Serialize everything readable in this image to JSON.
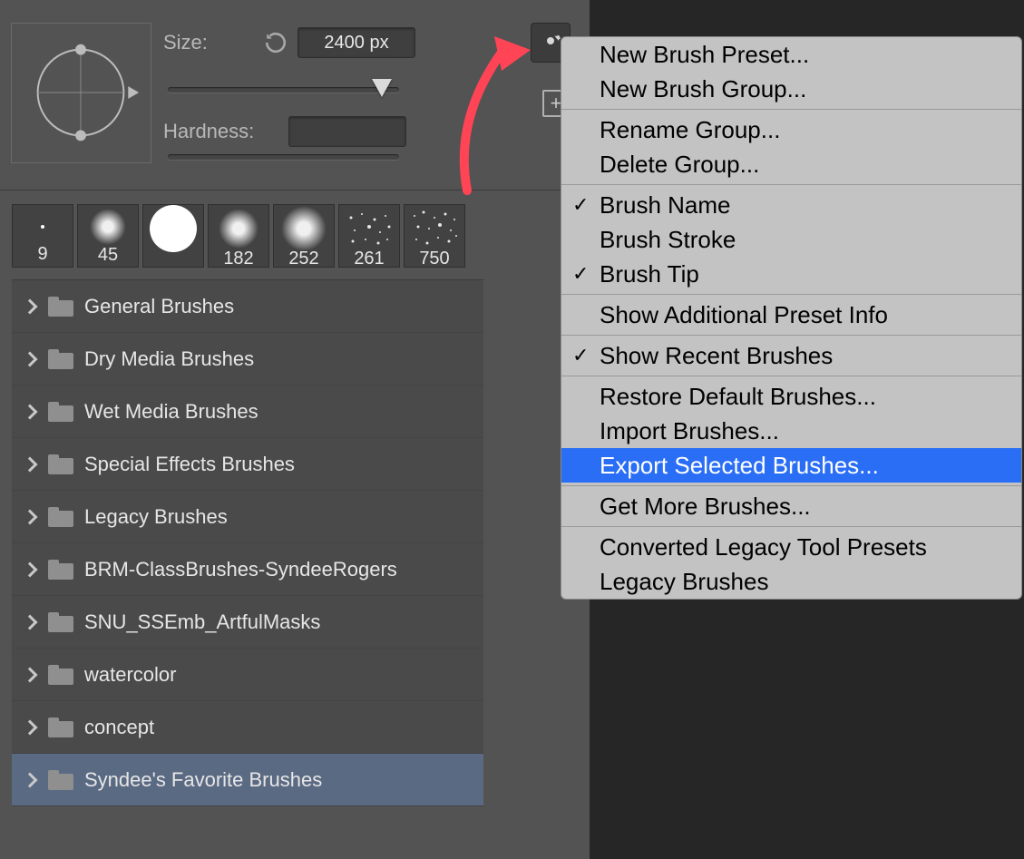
{
  "controls": {
    "size_label": "Size:",
    "size_value": "2400 px",
    "hardness_label": "Hardness:",
    "hardness_value": ""
  },
  "thumbs": [
    {
      "size": "9"
    },
    {
      "size": "45"
    },
    {
      "size": ""
    },
    {
      "size": "182"
    },
    {
      "size": "252"
    },
    {
      "size": "261"
    },
    {
      "size": "750"
    }
  ],
  "folders": [
    {
      "name": "General Brushes",
      "selected": false
    },
    {
      "name": "Dry Media Brushes",
      "selected": false
    },
    {
      "name": "Wet Media Brushes",
      "selected": false
    },
    {
      "name": "Special Effects Brushes",
      "selected": false
    },
    {
      "name": "Legacy Brushes",
      "selected": false
    },
    {
      "name": "BRM-ClassBrushes-SyndeeRogers",
      "selected": false
    },
    {
      "name": "SNU_SSEmb_ArtfulMasks",
      "selected": false
    },
    {
      "name": "watercolor",
      "selected": false
    },
    {
      "name": "concept",
      "selected": false
    },
    {
      "name": "Syndee's Favorite Brushes",
      "selected": true
    }
  ],
  "menu": [
    {
      "type": "item",
      "label": "New Brush Preset..."
    },
    {
      "type": "item",
      "label": "New Brush Group..."
    },
    {
      "type": "sep"
    },
    {
      "type": "item",
      "label": "Rename Group..."
    },
    {
      "type": "item",
      "label": "Delete Group..."
    },
    {
      "type": "sep"
    },
    {
      "type": "item",
      "label": "Brush Name",
      "checked": true
    },
    {
      "type": "item",
      "label": "Brush Stroke"
    },
    {
      "type": "item",
      "label": "Brush Tip",
      "checked": true
    },
    {
      "type": "sep"
    },
    {
      "type": "item",
      "label": "Show Additional Preset Info"
    },
    {
      "type": "sep"
    },
    {
      "type": "item",
      "label": "Show Recent Brushes",
      "checked": true
    },
    {
      "type": "sep"
    },
    {
      "type": "item",
      "label": "Restore Default Brushes..."
    },
    {
      "type": "item",
      "label": "Import Brushes..."
    },
    {
      "type": "item",
      "label": "Export Selected Brushes...",
      "highlight": true
    },
    {
      "type": "sep"
    },
    {
      "type": "item",
      "label": "Get More Brushes..."
    },
    {
      "type": "sep"
    },
    {
      "type": "item",
      "label": "Converted Legacy Tool Presets"
    },
    {
      "type": "item",
      "label": "Legacy Brushes"
    }
  ]
}
